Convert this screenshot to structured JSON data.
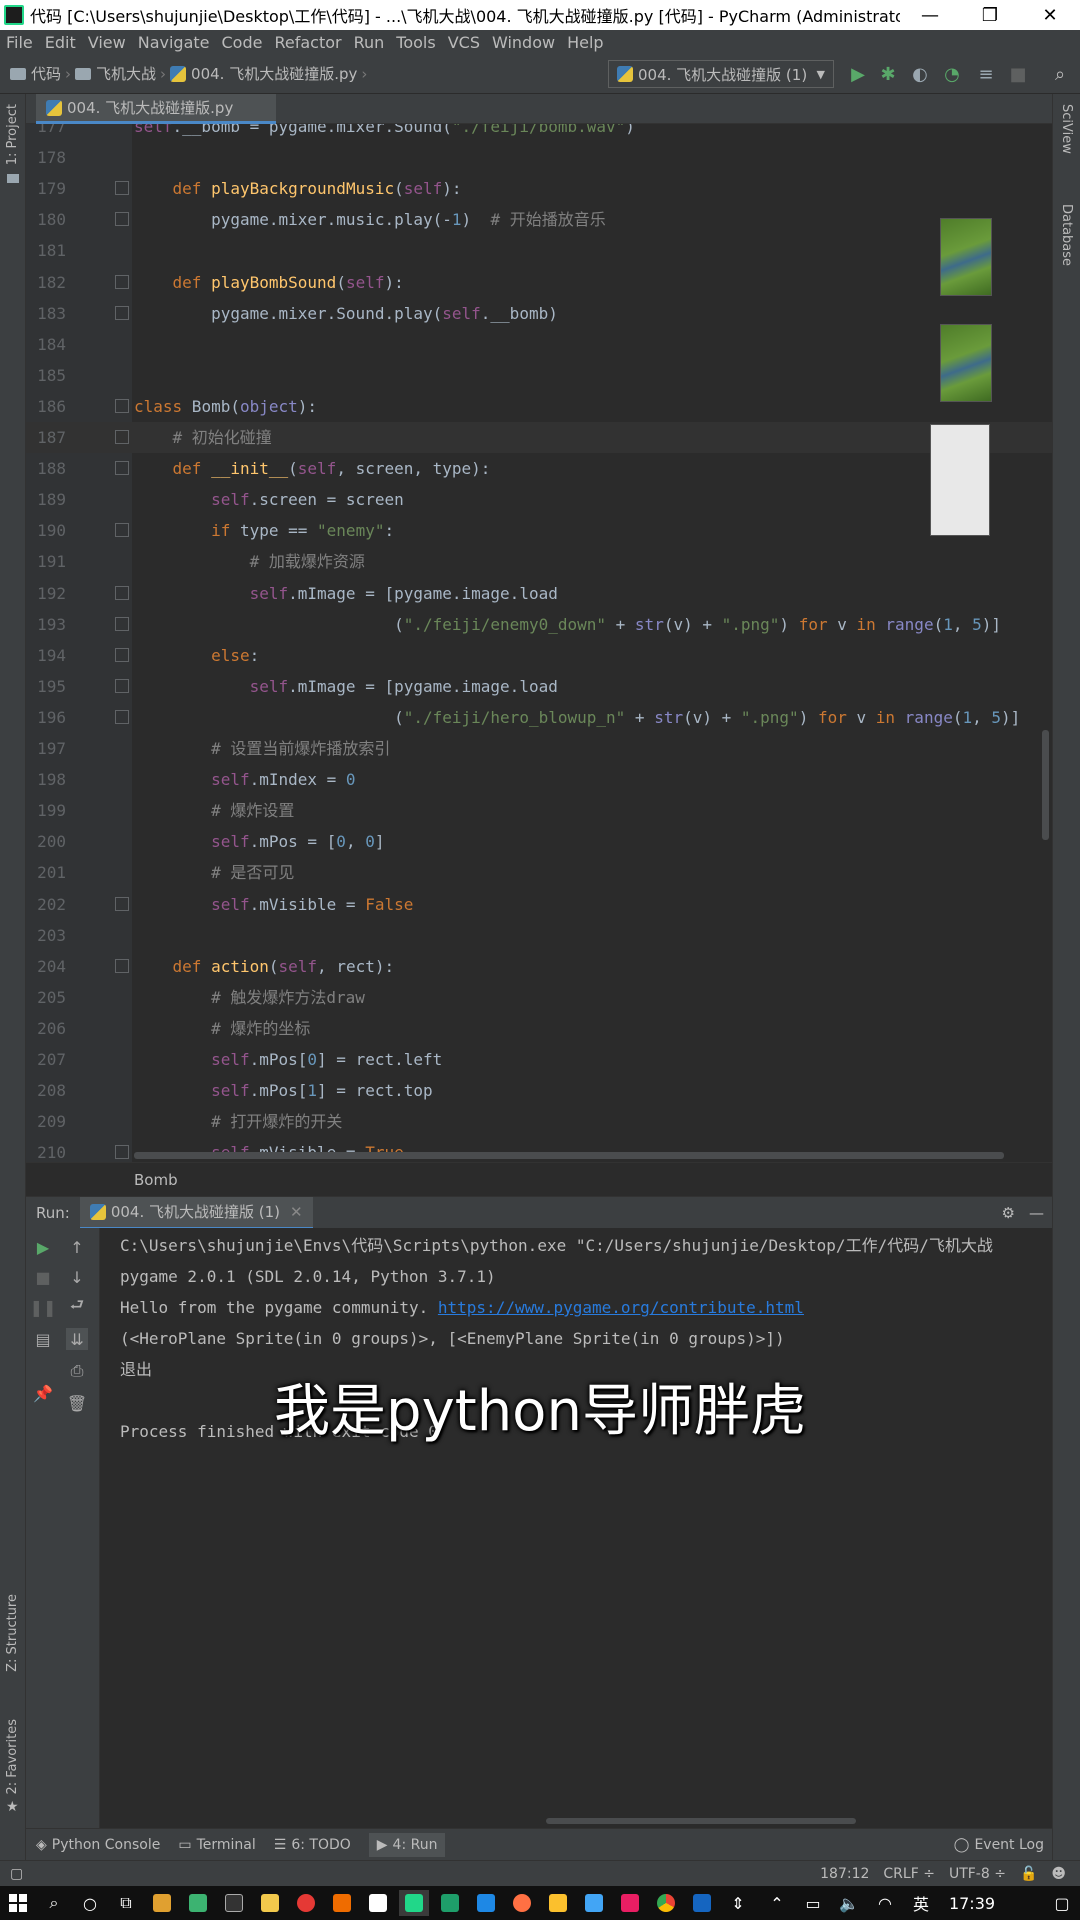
{
  "window": {
    "title": "代码 [C:\\Users\\shujunjie\\Desktop\\工作\\代码] - ...\\飞机大战\\004. 飞机大战碰撞版.py [代码] - PyCharm (Administrator)"
  },
  "menu": [
    "File",
    "Edit",
    "View",
    "Navigate",
    "Code",
    "Refactor",
    "Run",
    "Tools",
    "VCS",
    "Window",
    "Help"
  ],
  "breadcrumb": {
    "root": "代码",
    "folder": "飞机大战",
    "file": "004. 飞机大战碰撞版.py"
  },
  "run_config": "004. 飞机大战碰撞版 (1)",
  "editor_tab": "004. 飞机大战碰撞版.py",
  "left_tools": {
    "project": "1: Project",
    "structure": "Z: Structure",
    "favorites": "2: Favorites"
  },
  "right_tools": {
    "sciview": "SciView",
    "database": "Database"
  },
  "code_lines": [
    {
      "n": "177",
      "html": "<span class='sf'>self</span>.__bomb = pygame.mixer.Sound(<span class='s'>\"./feiji/bomb.wav\"</span>)"
    },
    {
      "n": "178",
      "html": ""
    },
    {
      "n": "179",
      "html": "    <span class='k'>def</span> <span class='fn'>playBackgroundMusic</span>(<span class='sf'>self</span>):"
    },
    {
      "n": "180",
      "html": "        pygame.mixer.music.play(-<span class='n'>1</span>)  <span class='c'># 开始播放音乐</span>"
    },
    {
      "n": "181",
      "html": ""
    },
    {
      "n": "182",
      "html": "    <span class='k'>def</span> <span class='fn'>playBombSound</span>(<span class='sf'>self</span>):"
    },
    {
      "n": "183",
      "html": "        pygame.mixer.Sound.play(<span class='sf'>self</span>.__bomb)"
    },
    {
      "n": "184",
      "html": ""
    },
    {
      "n": "185",
      "html": ""
    },
    {
      "n": "186",
      "html": "<span class='k'>class</span> Bomb(<span class='bi'>object</span>):"
    },
    {
      "n": "187",
      "html": "    <span class='c'># 初始化碰撞</span>"
    },
    {
      "n": "188",
      "html": "    <span class='k'>def</span> <span class='fn'>__init__</span>(<span class='sf'>self</span>, screen, type):"
    },
    {
      "n": "189",
      "html": "        <span class='sf'>self</span>.screen = screen"
    },
    {
      "n": "190",
      "html": "        <span class='k'>if</span> type == <span class='s'>\"enemy\"</span>:"
    },
    {
      "n": "191",
      "html": "            <span class='c'># 加载爆炸资源</span>"
    },
    {
      "n": "192",
      "html": "            <span class='sf'>self</span>.mImage = [pygame.image.load"
    },
    {
      "n": "193",
      "html": "                           (<span class='s'>\"./feiji/enemy0_down\"</span> + <span class='bi'>str</span>(v) + <span class='s'>\".png\"</span>) <span class='k'>for</span> v <span class='k'>in</span> <span class='bi'>range</span>(<span class='n'>1</span>, <span class='n'>5</span>)]"
    },
    {
      "n": "194",
      "html": "        <span class='k'>else</span>:"
    },
    {
      "n": "195",
      "html": "            <span class='sf'>self</span>.mImage = [pygame.image.load"
    },
    {
      "n": "196",
      "html": "                           (<span class='s'>\"./feiji/hero_blowup_n\"</span> + <span class='bi'>str</span>(v) + <span class='s'>\".png\"</span>) <span class='k'>for</span> v <span class='k'>in</span> <span class='bi'>range</span>(<span class='n'>1</span>, <span class='n'>5</span>)]"
    },
    {
      "n": "197",
      "html": "        <span class='c'># 设置当前爆炸播放索引</span>"
    },
    {
      "n": "198",
      "html": "        <span class='sf'>self</span>.mIndex = <span class='n'>0</span>"
    },
    {
      "n": "199",
      "html": "        <span class='c'># 爆炸设置</span>"
    },
    {
      "n": "200",
      "html": "        <span class='sf'>self</span>.mPos = [<span class='n'>0</span>, <span class='n'>0</span>]"
    },
    {
      "n": "201",
      "html": "        <span class='c'># 是否可见</span>"
    },
    {
      "n": "202",
      "html": "        <span class='sf'>self</span>.mVisible = <span class='k'>False</span>"
    },
    {
      "n": "203",
      "html": ""
    },
    {
      "n": "204",
      "html": "    <span class='k'>def</span> <span class='fn'>action</span>(<span class='sf'>self</span>, rect):"
    },
    {
      "n": "205",
      "html": "        <span class='c'># 触发爆炸方法draw</span>"
    },
    {
      "n": "206",
      "html": "        <span class='c'># 爆炸的坐标</span>"
    },
    {
      "n": "207",
      "html": "        <span class='sf'>self</span>.mPos[<span class='n'>0</span>] = rect.left"
    },
    {
      "n": "208",
      "html": "        <span class='sf'>self</span>.mPos[<span class='n'>1</span>] = rect.top"
    },
    {
      "n": "209",
      "html": "        <span class='c'># 打开爆炸的开关</span>"
    },
    {
      "n": "210",
      "html": "        <span class='sf'>self</span>.mVisible = <span class='k'>True</span>"
    }
  ],
  "editor_breadcrumb": "Bomb",
  "run_panel": {
    "label": "Run:",
    "tab": "004. 飞机大战碰撞版 (1)"
  },
  "output": {
    "line1": "C:\\Users\\shujunjie\\Envs\\代码\\Scripts\\python.exe \"C:/Users/shujunjie/Desktop/工作/代码/飞机大战",
    "line2": "pygame 2.0.1 (SDL 2.0.14, Python 3.7.1)",
    "line3_prefix": "Hello from the pygame community. ",
    "line3_link": "https://www.pygame.org/contribute.html",
    "line4": "(<HeroPlane Sprite(in 0 groups)>, [<EnemyPlane Sprite(in 0 groups)>])",
    "line5": "退出",
    "line6": "Process finished with exit code 0"
  },
  "subtitle": "我是python导师胖虎",
  "bottom_tools": [
    "Python Console",
    "Terminal",
    "6: TODO",
    "4: Run"
  ],
  "event_log": "Event Log",
  "status": {
    "position": "187:12",
    "line_sep": "CRLF ÷",
    "encoding": "UTF-8 ÷"
  },
  "taskbar": {
    "ime": "英",
    "time": "17:39"
  }
}
